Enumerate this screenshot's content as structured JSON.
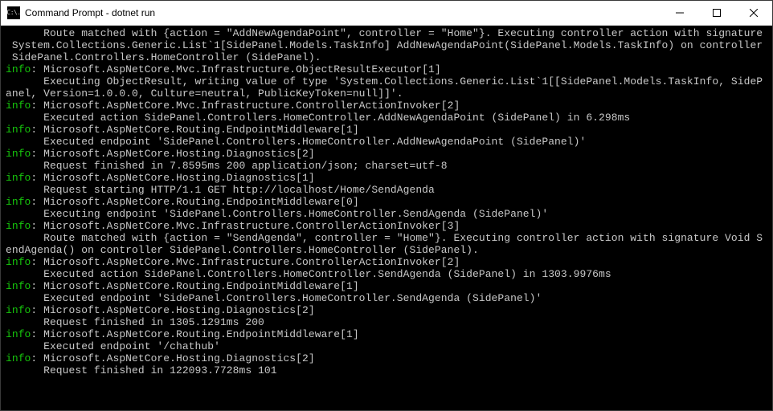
{
  "titlebar": {
    "icon_text": "C:\\.",
    "title": "Command Prompt - dotnet  run"
  },
  "log": {
    "l01": "      Route matched with {action = \"AddNewAgendaPoint\", controller = \"Home\"}. Executing controller action with signature",
    "l02": " System.Collections.Generic.List`1[SidePanel.Models.TaskInfo] AddNewAgendaPoint(SidePanel.Models.TaskInfo) on controller",
    "l03": " SidePanel.Controllers.HomeController (SidePanel).",
    "l04p": "info",
    "l04": ": Microsoft.AspNetCore.Mvc.Infrastructure.ObjectResultExecutor[1]",
    "l05": "      Executing ObjectResult, writing value of type 'System.Collections.Generic.List`1[[SidePanel.Models.TaskInfo, SideP",
    "l06": "anel, Version=1.0.0.0, Culture=neutral, PublicKeyToken=null]]'.",
    "l07p": "info",
    "l07": ": Microsoft.AspNetCore.Mvc.Infrastructure.ControllerActionInvoker[2]",
    "l08": "      Executed action SidePanel.Controllers.HomeController.AddNewAgendaPoint (SidePanel) in 6.298ms",
    "l09p": "info",
    "l09": ": Microsoft.AspNetCore.Routing.EndpointMiddleware[1]",
    "l10": "      Executed endpoint 'SidePanel.Controllers.HomeController.AddNewAgendaPoint (SidePanel)'",
    "l11p": "info",
    "l11": ": Microsoft.AspNetCore.Hosting.Diagnostics[2]",
    "l12": "      Request finished in 7.8595ms 200 application/json; charset=utf-8",
    "l13p": "info",
    "l13": ": Microsoft.AspNetCore.Hosting.Diagnostics[1]",
    "l14": "      Request starting HTTP/1.1 GET http://localhost/Home/SendAgenda",
    "l15p": "info",
    "l15": ": Microsoft.AspNetCore.Routing.EndpointMiddleware[0]",
    "l16": "      Executing endpoint 'SidePanel.Controllers.HomeController.SendAgenda (SidePanel)'",
    "l17p": "info",
    "l17": ": Microsoft.AspNetCore.Mvc.Infrastructure.ControllerActionInvoker[3]",
    "l18": "      Route matched with {action = \"SendAgenda\", controller = \"Home\"}. Executing controller action with signature Void S",
    "l19": "endAgenda() on controller SidePanel.Controllers.HomeController (SidePanel).",
    "l20p": "info",
    "l20": ": Microsoft.AspNetCore.Mvc.Infrastructure.ControllerActionInvoker[2]",
    "l21": "      Executed action SidePanel.Controllers.HomeController.SendAgenda (SidePanel) in 1303.9976ms",
    "l22p": "info",
    "l22": ": Microsoft.AspNetCore.Routing.EndpointMiddleware[1]",
    "l23": "      Executed endpoint 'SidePanel.Controllers.HomeController.SendAgenda (SidePanel)'",
    "l24p": "info",
    "l24": ": Microsoft.AspNetCore.Hosting.Diagnostics[2]",
    "l25": "      Request finished in 1305.1291ms 200",
    "l26p": "info",
    "l26": ": Microsoft.AspNetCore.Routing.EndpointMiddleware[1]",
    "l27": "      Executed endpoint '/chathub'",
    "l28p": "info",
    "l28": ": Microsoft.AspNetCore.Hosting.Diagnostics[2]",
    "l29": "      Request finished in 122093.7728ms 101"
  }
}
